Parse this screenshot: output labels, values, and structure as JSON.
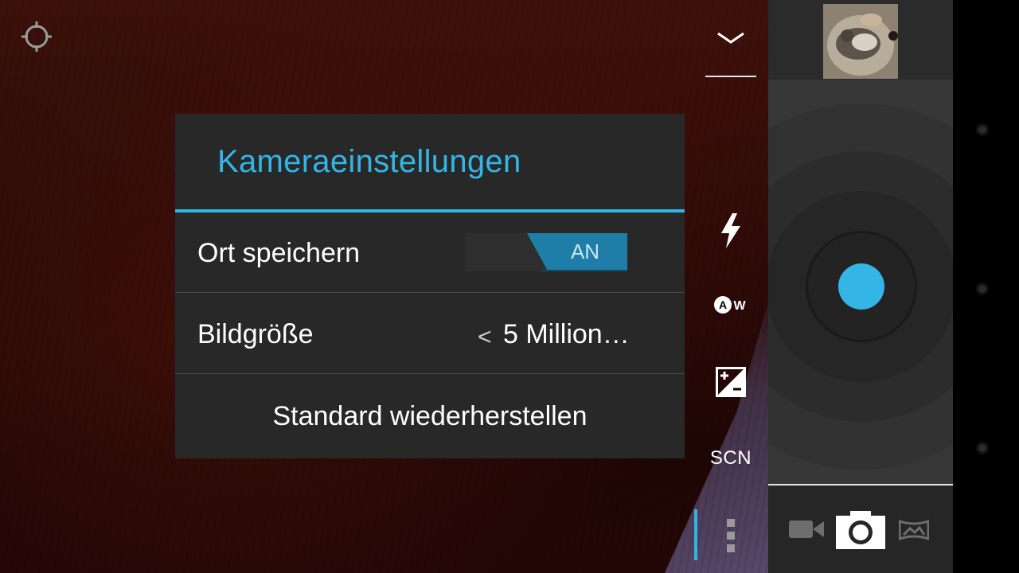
{
  "dialog": {
    "title": "Kameraeinstellungen",
    "location_label": "Ort speichern",
    "location_toggle": "AN",
    "picture_size_label": "Bildgröße",
    "picture_size_value": "5 Million…",
    "picture_size_arrow": "<",
    "restore_label": "Standard wiederherstellen"
  },
  "settings_strip": {
    "collapse_icon": "chevron-down-icon",
    "flash_icon": "flash-icon",
    "white_balance_icon": "white-balance-auto-icon",
    "exposure_icon": "exposure-icon",
    "scene_label": "SCN",
    "more_icon": "more-vertical-icon"
  },
  "shutter_panel": {
    "thumbnail": "last-photo-thumbnail",
    "modes": [
      "video-icon",
      "camera-icon",
      "panorama-icon"
    ]
  },
  "colors": {
    "accent": "#33b5e5",
    "dialog_bg": "#282828",
    "toggle_on": "#1f7ea8"
  }
}
